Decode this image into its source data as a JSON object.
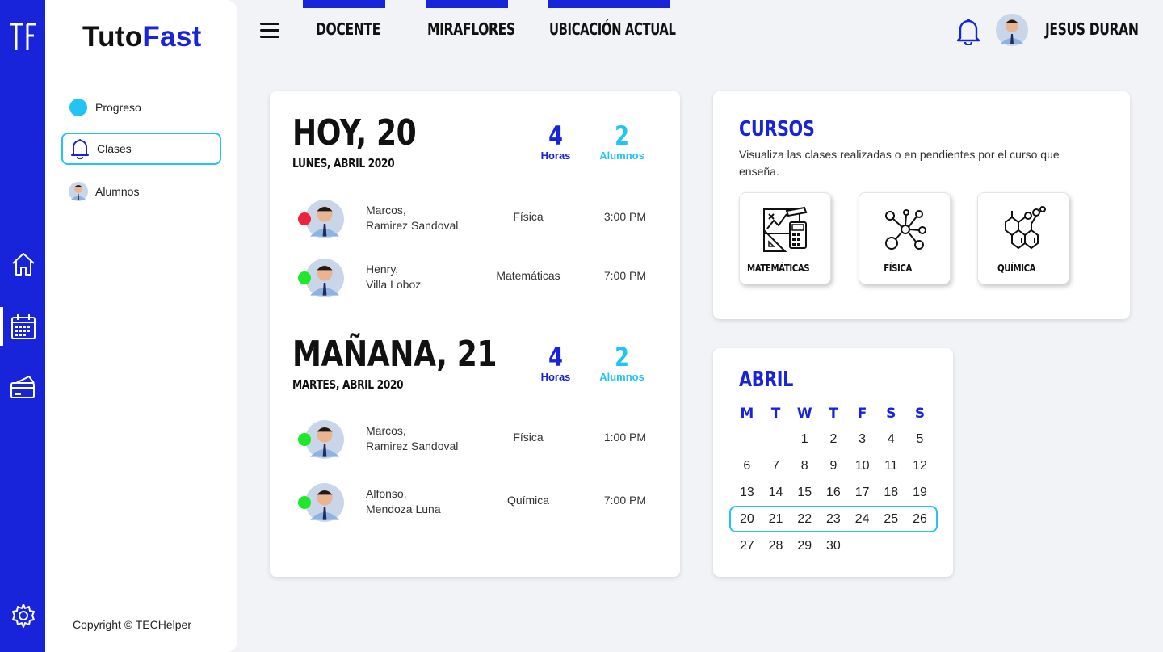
{
  "app": {
    "brand_part1": "Tuto",
    "brand_part2": "Fast"
  },
  "rail": {
    "icons": [
      "tutofast-logo-icon",
      "home-icon",
      "calendar-icon",
      "payment-card-icon",
      "gear-icon"
    ]
  },
  "sidebar": {
    "items": [
      {
        "label": "Progreso",
        "icon": "progress-dot-icon"
      },
      {
        "label": "Clases",
        "icon": "bell-icon"
      },
      {
        "label": "Alumnos",
        "icon": "student-avatar"
      }
    ],
    "copyright": "Copyright © TECHelper"
  },
  "topbar": {
    "tabs": [
      "DOCENTE",
      "MIRAFLORES",
      "UBICACIÓN ACTUAL"
    ],
    "user_name": "JESUS DURAN"
  },
  "schedule": {
    "days": [
      {
        "title": "HOY, 20",
        "subtitle": "LUNES, ABRIL 2020",
        "hours": "4",
        "hours_label": "Horas",
        "students": "2",
        "students_label": "Alumnos",
        "classes": [
          {
            "name1": "Marcos,",
            "name2": "Ramirez Sandoval",
            "subject": "Física",
            "time": "3:00 PM",
            "status_color": "#f0213a"
          },
          {
            "name1": "Henry,",
            "name2": "Villa Loboz",
            "subject": "Matemáticas",
            "time": "7:00 PM",
            "status_color": "#1ee82c"
          }
        ]
      },
      {
        "title": "MAÑANA, 21",
        "subtitle": "MARTES, ABRIL 2020",
        "hours": "4",
        "hours_label": "Horas",
        "students": "2",
        "students_label": "Alumnos",
        "classes": [
          {
            "name1": "Marcos,",
            "name2": "Ramirez Sandoval",
            "subject": "Física",
            "time": "1:00 PM",
            "status_color": "#1ee82c"
          },
          {
            "name1": "Alfonso,",
            "name2": "Mendoza Luna",
            "subject": "Química",
            "time": "7:00 PM",
            "status_color": "#1ee82c"
          }
        ]
      }
    ]
  },
  "cursos": {
    "title": "CURSOS",
    "description": "Visualiza las clases realizadas o en pendientes por el curso que enseña.",
    "items": [
      {
        "label": "MATEMÁTICAS",
        "icon": "math-tools-icon"
      },
      {
        "label": "FÍSICA",
        "icon": "atom-molecule-icon"
      },
      {
        "label": "QUÍMICA",
        "icon": "chemical-structure-icon"
      }
    ]
  },
  "calendar": {
    "month": "ABRIL",
    "weekdays": [
      "M",
      "T",
      "W",
      "T",
      "F",
      "S",
      "S"
    ],
    "weeks": [
      [
        "",
        "",
        "1",
        "2",
        "3",
        "4",
        "5"
      ],
      [
        "6",
        "7",
        "8",
        "9",
        "10",
        "11",
        "12"
      ],
      [
        "13",
        "14",
        "15",
        "16",
        "17",
        "18",
        "19"
      ],
      [
        "20",
        "21",
        "22",
        "23",
        "24",
        "25",
        "26"
      ],
      [
        "27",
        "28",
        "29",
        "30",
        "",
        "",
        ""
      ]
    ],
    "current_week_index": 3
  },
  "colors": {
    "primary": "#1724d9",
    "accent": "#21c4f3",
    "status_red": "#f0213a",
    "status_green": "#1ee82c"
  }
}
